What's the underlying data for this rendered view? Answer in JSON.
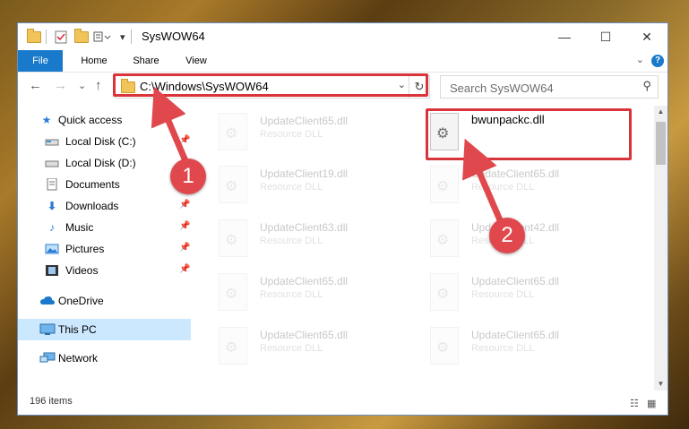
{
  "window": {
    "title": "SysWOW64",
    "minimize_glyph": "—",
    "maximize_glyph": "☐",
    "close_glyph": "✕"
  },
  "ribbon": {
    "tabs": [
      "File",
      "Home",
      "Share",
      "View"
    ],
    "help_glyph": "?"
  },
  "nav": {
    "back_glyph": "←",
    "forward_glyph": "→",
    "recent_glyph": "⌄",
    "up_glyph": "↑",
    "address": "C:\\Windows\\SysWOW64",
    "search_placeholder": "Search SysWOW64"
  },
  "sidebar": {
    "items": [
      {
        "label": "Quick access",
        "icon": "star-icon",
        "pinned": false
      },
      {
        "label": "Local Disk (C:)",
        "icon": "drive-icon",
        "pinned": true
      },
      {
        "label": "Local Disk (D:)",
        "icon": "drive-icon",
        "pinned": false
      },
      {
        "label": "Documents",
        "icon": "documents-icon",
        "pinned": true
      },
      {
        "label": "Downloads",
        "icon": "download-icon",
        "pinned": true
      },
      {
        "label": "Music",
        "icon": "music-icon",
        "pinned": true
      },
      {
        "label": "Pictures",
        "icon": "pictures-icon",
        "pinned": true
      },
      {
        "label": "Videos",
        "icon": "videos-icon",
        "pinned": true
      },
      {
        "label": "OneDrive",
        "icon": "cloud-icon",
        "pinned": false
      },
      {
        "label": "This PC",
        "icon": "pc-icon",
        "pinned": false,
        "selected": true
      },
      {
        "label": "Network",
        "icon": "network-icon",
        "pinned": false
      }
    ]
  },
  "files": {
    "left": [
      {
        "name": "UpdateClient65.dll",
        "type": "Resource DLL"
      },
      {
        "name": "UpdateClient19.dll",
        "type": "Resource DLL"
      },
      {
        "name": "UpdateClient63.dll",
        "type": "Resource DLL"
      },
      {
        "name": "UpdateClient65.dll",
        "type": "Resource DLL"
      },
      {
        "name": "UpdateClient65.dll",
        "type": "Resource DLL"
      }
    ],
    "right": [
      {
        "name": "bwunpackc.dll",
        "type": ""
      },
      {
        "name": "UpdateClient65.dll",
        "type": "Resource DLL"
      },
      {
        "name": "UpdateClient42.dll",
        "type": "Resource DLL"
      },
      {
        "name": "UpdateClient65.dll",
        "type": "Resource DLL"
      },
      {
        "name": "UpdateClient65.dll",
        "type": "Resource DLL"
      }
    ]
  },
  "status": {
    "item_count": "196 items"
  },
  "annotations": {
    "marker1": "1",
    "marker2": "2",
    "color": "#e0484d"
  }
}
